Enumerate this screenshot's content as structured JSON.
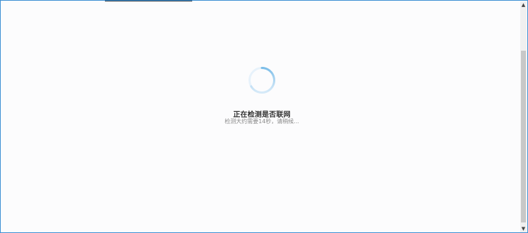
{
  "loading": {
    "title": "正在检测是否联网",
    "subtitle": "检测大约需要14秒，请稍候..."
  },
  "scrollbar": {
    "up_icon": "chevron-up-icon",
    "down_icon": "chevron-down-icon"
  },
  "colors": {
    "window_border": "#3c8fd3",
    "spinner": "#7bbde8",
    "background": "#fcfcfd"
  }
}
